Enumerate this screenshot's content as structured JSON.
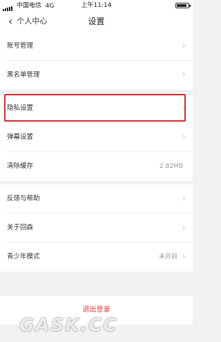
{
  "status_bar": {
    "carrier": "中国电信",
    "network": "4G",
    "time": "上午11:14"
  },
  "nav": {
    "back_label": "个人中心",
    "title": "设置"
  },
  "groups": [
    {
      "items": [
        {
          "label": "账号管理"
        },
        {
          "label": "黑名单管理"
        }
      ]
    },
    {
      "items": [
        {
          "label": "隐私设置",
          "highlighted": true
        },
        {
          "label": "弹幕设置"
        },
        {
          "label": "清除缓存",
          "value": "2.82MB"
        }
      ]
    },
    {
      "items": [
        {
          "label": "反馈与帮助"
        },
        {
          "label": "关于回森"
        },
        {
          "label": "青少年模式",
          "value": "未开启"
        }
      ]
    }
  ],
  "logout_label": "退出登录",
  "watermark": "GASK.CC",
  "colors": {
    "highlight_border": "#d6282a",
    "logout_text": "#e23b3b",
    "background": "#f2f2f4"
  }
}
